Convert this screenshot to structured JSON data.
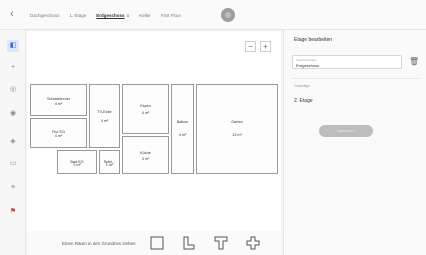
{
  "header": {
    "back_icon": "back-chevron-icon",
    "tabs": [
      {
        "label": "Dachgeschoss",
        "active": false
      },
      {
        "label": "1. Etage",
        "active": false
      },
      {
        "label": "Erdgeschoss",
        "active": true
      },
      {
        "label": "Keller",
        "active": false
      },
      {
        "label": "First Floor",
        "active": false
      }
    ],
    "active_tab_menu_icon": "≡",
    "add_floor_icon": "add-floor-icon"
  },
  "toolbar": {
    "items": [
      {
        "name": "select-tool-icon",
        "glyph": "◧",
        "selected": true
      },
      {
        "name": "add-tool-icon",
        "glyph": "+"
      },
      {
        "name": "circle-tool-icon",
        "glyph": "◎"
      },
      {
        "name": "target-tool-icon",
        "glyph": "◉"
      },
      {
        "name": "shield-tool-icon",
        "glyph": "◈"
      },
      {
        "name": "image-tool-icon",
        "glyph": "▭"
      },
      {
        "name": "layers-tool-icon",
        "glyph": "≡"
      },
      {
        "name": "tag-tool-icon",
        "glyph": "⚑",
        "red": true
      }
    ]
  },
  "canvas": {
    "zoom_out": "−",
    "zoom_in": "+",
    "rooms": [
      {
        "name": "Schlafzimmer",
        "area": "4 m²"
      },
      {
        "name": "TV-Ecke",
        "area": "4 m²"
      },
      {
        "name": "Essen",
        "area": "4 m²"
      },
      {
        "name": "Balkon",
        "area": "4 m²"
      },
      {
        "name": "Garten",
        "area": "13 m²"
      },
      {
        "name": "Flur EG",
        "area": "4 m²"
      },
      {
        "name": "Bad EG",
        "area": "2 m²"
      },
      {
        "name": "Spiel...",
        "area": "1 m²"
      },
      {
        "name": "Küche",
        "area": "3 m²"
      }
    ]
  },
  "bottombar": {
    "label": "Einen Raum in den Grundriss ziehen",
    "shapes": [
      "square-room-icon",
      "l-shape-room-icon",
      "t-shape-room-icon",
      "cross-shape-room-icon"
    ]
  },
  "panel": {
    "title": "Etage bearbeiten",
    "field_label": "Geschossname",
    "field_value": "Erdgeschoss",
    "trash_icon": "🗑",
    "section_label": "Vorschläge",
    "option": "2. Etage",
    "apply_label": "Speichern"
  },
  "colors": {
    "accent": "#3c6fd6",
    "selected_tool_bg": "#dce8ff",
    "button_disabled": "#bdbdbd"
  }
}
